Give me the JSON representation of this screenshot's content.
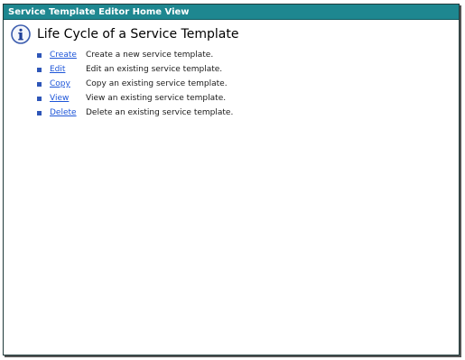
{
  "window": {
    "title": "Service Template Editor Home View"
  },
  "page": {
    "title": "Life Cycle of a Service Template",
    "icon": "info-icon"
  },
  "actions": [
    {
      "label": "Create",
      "description": "Create a new service template."
    },
    {
      "label": "Edit",
      "description": "Edit an existing service template."
    },
    {
      "label": "Copy",
      "description": "Copy an existing service template."
    },
    {
      "label": "View",
      "description": "View an existing service template."
    },
    {
      "label": "Delete",
      "description": "Delete an existing service template."
    }
  ],
  "colors": {
    "titlebar": "#1e8790",
    "link": "#1d55d8",
    "bullet": "#2e56b8"
  }
}
